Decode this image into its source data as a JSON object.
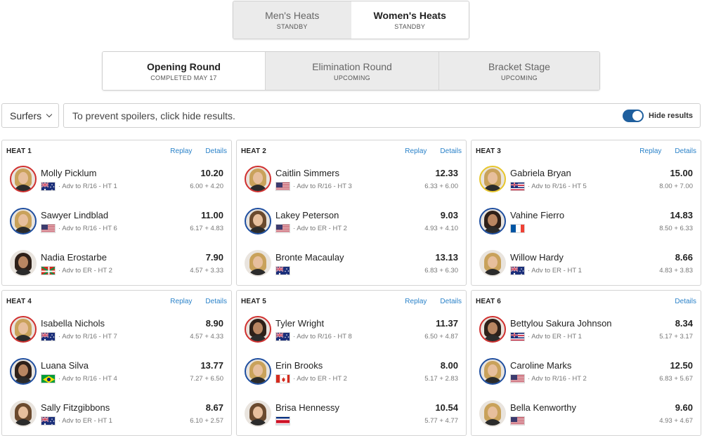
{
  "gender_tabs": [
    {
      "label": "Men's Heats",
      "status": "STANDBY",
      "active": false
    },
    {
      "label": "Women's Heats",
      "status": "STANDBY",
      "active": true
    }
  ],
  "round_tabs": [
    {
      "label": "Opening Round",
      "status": "COMPLETED MAY 17",
      "active": true
    },
    {
      "label": "Elimination Round",
      "status": "UPCOMING",
      "active": false
    },
    {
      "label": "Bracket Stage",
      "status": "UPCOMING",
      "active": false
    }
  ],
  "filter": {
    "surfers_label": "Surfers",
    "spoiler_text": "To prevent spoilers, click hide results.",
    "toggle_label": "Hide results"
  },
  "links": {
    "replay": "Replay",
    "details": "Details"
  },
  "heats": [
    {
      "title": "HEAT 1",
      "has_replay": true,
      "surfers": [
        {
          "name": "Molly Picklum",
          "score": "10.20",
          "flag": "australia-flag",
          "adv": "· Adv to R/16 - HT 1",
          "waves": "6.00 + 4.20",
          "ring": "red",
          "hair": "blonde"
        },
        {
          "name": "Sawyer Lindblad",
          "score": "11.00",
          "flag": "usa-flag",
          "adv": "· Adv to R/16 - HT 6",
          "waves": "6.17 + 4.83",
          "ring": "blue",
          "hair": "blonde"
        },
        {
          "name": "Nadia Erostarbe",
          "score": "7.90",
          "flag": "basque-flag",
          "adv": "· Adv to ER - HT 2",
          "waves": "4.57 + 3.33",
          "ring": "none",
          "hair": "dark"
        }
      ]
    },
    {
      "title": "HEAT 2",
      "has_replay": true,
      "surfers": [
        {
          "name": "Caitlin Simmers",
          "score": "12.33",
          "flag": "usa-flag",
          "adv": "· Adv to R/16 - HT 3",
          "waves": "6.33 + 6.00",
          "ring": "red",
          "hair": "blonde"
        },
        {
          "name": "Lakey Peterson",
          "score": "9.03",
          "flag": "usa-flag",
          "adv": "· Adv to ER - HT 2",
          "waves": "4.93 + 4.10",
          "ring": "blue",
          "hair": "brown"
        },
        {
          "name": "Bronte Macaulay",
          "score": "13.13",
          "flag": "australia-flag",
          "adv": "",
          "waves": "6.83 + 6.30",
          "ring": "none",
          "hair": "blonde"
        }
      ]
    },
    {
      "title": "HEAT 3",
      "has_replay": true,
      "surfers": [
        {
          "name": "Gabriela Bryan",
          "score": "15.00",
          "flag": "hawaii-flag",
          "adv": "· Adv to R/16 - HT 5",
          "waves": "8.00 + 7.00",
          "ring": "yellow",
          "hair": "blonde"
        },
        {
          "name": "Vahine Fierro",
          "score": "14.83",
          "flag": "france-flag",
          "adv": "",
          "waves": "8.50 + 6.33",
          "ring": "blue",
          "hair": "dark"
        },
        {
          "name": "Willow Hardy",
          "score": "8.66",
          "flag": "australia-flag",
          "adv": "· Adv to ER - HT 1",
          "waves": "4.83 + 3.83",
          "ring": "none",
          "hair": "blonde"
        }
      ]
    },
    {
      "title": "HEAT 4",
      "has_replay": true,
      "surfers": [
        {
          "name": "Isabella Nichols",
          "score": "8.90",
          "flag": "australia-flag",
          "adv": "· Adv to R/16 - HT 7",
          "waves": "4.57 + 4.33",
          "ring": "red",
          "hair": "blonde"
        },
        {
          "name": "Luana Silva",
          "score": "13.77",
          "flag": "brazil-flag",
          "adv": "· Adv to R/16 - HT 4",
          "waves": "7.27 + 6.50",
          "ring": "blue",
          "hair": "dark"
        },
        {
          "name": "Sally Fitzgibbons",
          "score": "8.67",
          "flag": "australia-flag",
          "adv": "· Adv to ER - HT 1",
          "waves": "6.10 + 2.57",
          "ring": "none",
          "hair": "brown"
        }
      ]
    },
    {
      "title": "HEAT 5",
      "has_replay": true,
      "surfers": [
        {
          "name": "Tyler Wright",
          "score": "11.37",
          "flag": "australia-flag",
          "adv": "· Adv to R/16 - HT 8",
          "waves": "6.50 + 4.87",
          "ring": "red",
          "hair": "dark"
        },
        {
          "name": "Erin Brooks",
          "score": "8.00",
          "flag": "canada-flag",
          "adv": "· Adv to ER - HT 2",
          "waves": "5.17 + 2.83",
          "ring": "blue",
          "hair": "blonde"
        },
        {
          "name": "Brisa Hennessy",
          "score": "10.54",
          "flag": "costa-rica-flag",
          "adv": "",
          "waves": "5.77 + 4.77",
          "ring": "none",
          "hair": "brown"
        }
      ]
    },
    {
      "title": "HEAT 6",
      "has_replay": false,
      "surfers": [
        {
          "name": "Bettylou Sakura Johnson",
          "score": "8.34",
          "flag": "hawaii-flag",
          "adv": "· Adv to ER - HT 1",
          "waves": "5.17 + 3.17",
          "ring": "red",
          "hair": "dark"
        },
        {
          "name": "Caroline Marks",
          "score": "12.50",
          "flag": "usa-flag",
          "adv": "· Adv to R/16 - HT 2",
          "waves": "6.83 + 5.67",
          "ring": "blue",
          "hair": "blonde"
        },
        {
          "name": "Bella Kenworthy",
          "score": "9.60",
          "flag": "usa-flag",
          "adv": "",
          "waves": "4.93 + 4.67",
          "ring": "none",
          "hair": "blonde"
        }
      ]
    }
  ],
  "colors": {
    "accent": "#2a82c9",
    "toggle": "#1f5f9e",
    "ring_red": "#d0302f",
    "ring_blue": "#1f4fa0",
    "ring_yellow": "#e8c62b"
  }
}
